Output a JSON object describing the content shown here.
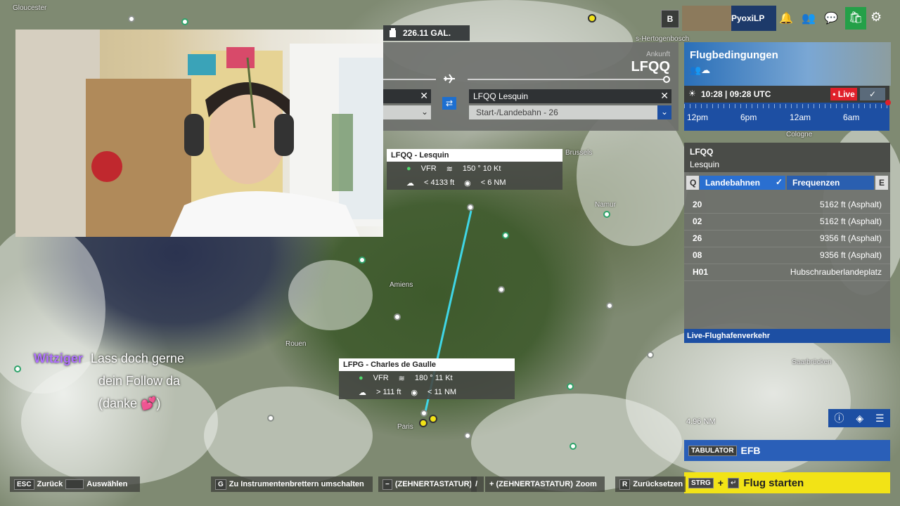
{
  "map": {
    "cities": [
      "Gloucester",
      "Amiens",
      "Rouen",
      "Paris",
      "Namur",
      "Cologne",
      "Saarbrücken",
      "s-Hertogenbosch",
      "Brussels"
    ]
  },
  "fuel": {
    "value": "226.11 GAL."
  },
  "route": {
    "arrival_label": "Ankunft",
    "arrival_code": "LFQQ",
    "arrival_airport": "LFQQ Lesquin",
    "runway_select": "Start-/Landebahn - 26"
  },
  "topbar": {
    "profile_badge": "B",
    "username": "PyoxiLP"
  },
  "weather": {
    "title": "Flugbedingungen"
  },
  "time": {
    "clock": "10:28 | 09:28 UTC",
    "live_label": "• Live",
    "ticks": [
      "12pm",
      "6pm",
      "12am",
      "6am"
    ]
  },
  "airport": {
    "code": "LFQQ",
    "name": "Lesquin",
    "tab_key_left": "Q",
    "tab_runways": "Landebahnen",
    "tab_frequencies": "Frequenzen",
    "tab_key_right": "E",
    "runways": [
      {
        "id": "20",
        "info": "5162 ft (Asphalt)"
      },
      {
        "id": "02",
        "info": "5162 ft (Asphalt)"
      },
      {
        "id": "26",
        "info": "9356 ft (Asphalt)"
      },
      {
        "id": "08",
        "info": "9356 ft (Asphalt)"
      },
      {
        "id": "H01",
        "info": "Hubschrauberlandeplatz"
      }
    ],
    "live_traffic": "Live-Flughafenverkehr"
  },
  "card_lfqq": {
    "title": "LFQQ - Lesquin",
    "rules": "VFR",
    "wind": "150 ° 10 Kt",
    "ceiling": "< 4133  ft",
    "visibility": "< 6  NM"
  },
  "card_lfpg": {
    "title": "LFPG - Charles de Gaulle",
    "rules": "VFR",
    "wind": "180 ° 11 Kt",
    "ceiling": "> 111  ft",
    "visibility": "< 11  NM"
  },
  "chat": {
    "user": "Witziger",
    "message_lines": [
      "Lass doch gerne",
      "dein Follow da",
      "(danke 💕)"
    ]
  },
  "scale": {
    "label": "4.96 NM"
  },
  "efb": {
    "key": "TABULATOR",
    "label": "EFB"
  },
  "start": {
    "key": "STRG",
    "plus": "+",
    "label": "Flug starten"
  },
  "hints": {
    "esc_key": "ESC",
    "back": "Zurück",
    "select": "Auswählen",
    "g_key": "G",
    "instruments": "Zu Instrumentenbrettern umschalten",
    "minus": "(ZEHNERTASTATUR)",
    "slash": "/",
    "plus": "+ (ZEHNERTASTATUR)",
    "zoom": "Zoom",
    "r_key": "R",
    "reset": "Zurücksetzen"
  },
  "colors": {
    "accent_blue": "#1d4fa3",
    "live_red": "#e0202a",
    "start_yellow": "#f2e316",
    "route_line": "#3fd6e6",
    "chat_user": "#b070ff"
  }
}
